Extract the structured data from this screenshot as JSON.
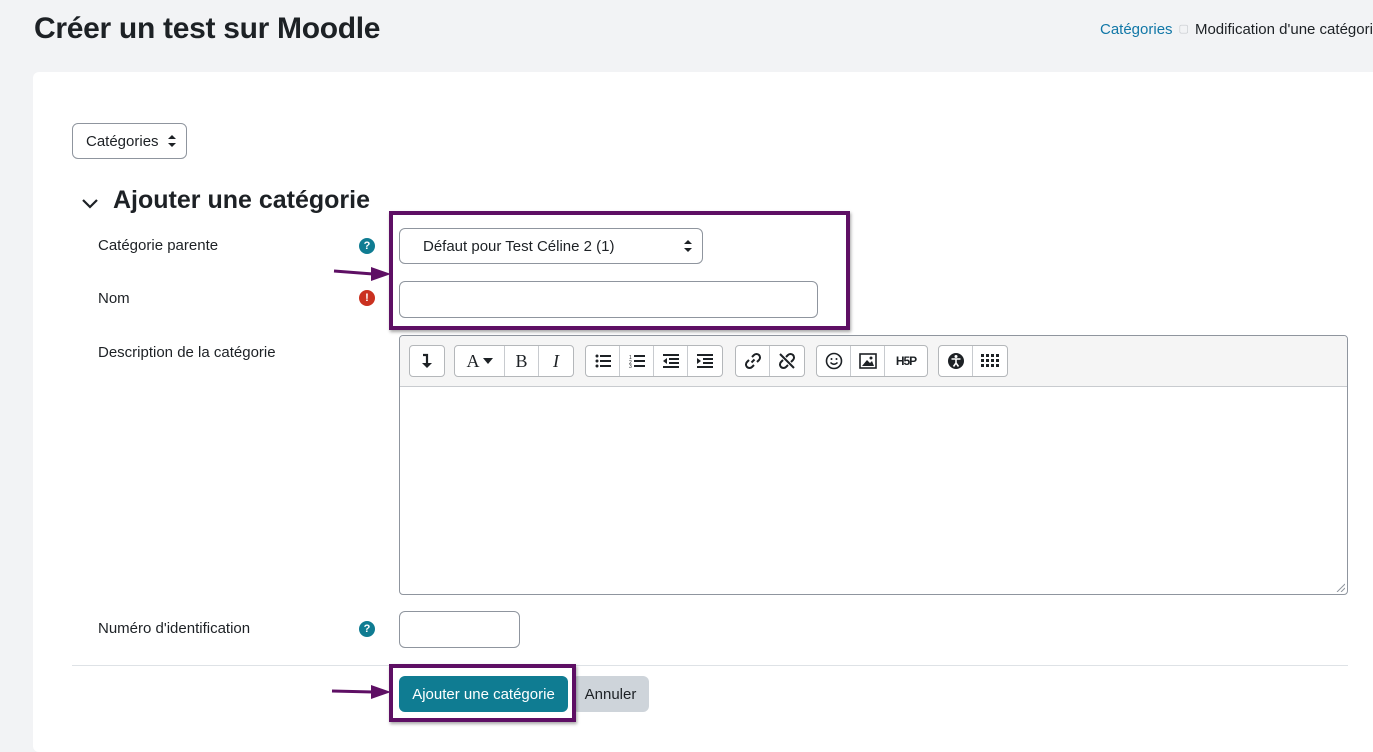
{
  "header": {
    "title": "Créer un test sur Moodle",
    "breadcrumb": [
      {
        "label": "Catégories",
        "link": true
      },
      {
        "label": "Modification d'une catégorie",
        "link": false
      }
    ]
  },
  "nav_select": {
    "value": "Catégories"
  },
  "section": {
    "title": "Ajouter une catégorie"
  },
  "form": {
    "parent_label": "Catégorie parente",
    "parent_value": "Défaut pour Test Céline 2 (1)",
    "name_label": "Nom",
    "name_value": "",
    "description_label": "Description de la catégorie",
    "idnumber_label": "Numéro d'identification",
    "idnumber_value": ""
  },
  "icons": {
    "help": "?",
    "required": "!"
  },
  "editor_toolbar": {
    "buttons": [
      "collapse",
      "font-style",
      "bold",
      "italic",
      "unordered-list",
      "ordered-list",
      "outdent",
      "indent",
      "link",
      "unlink",
      "emoji",
      "image",
      "h5p",
      "accessibility",
      "more"
    ],
    "bold_label": "B",
    "italic_label": "I",
    "font_label": "A",
    "h5p_label": "H5P"
  },
  "actions": {
    "submit_label": "Ajouter une catégorie",
    "cancel_label": "Annuler"
  },
  "colors": {
    "accent": "#0f7c92",
    "link": "#1177a7",
    "required": "#ca3120",
    "annotation": "#5e0f64"
  }
}
